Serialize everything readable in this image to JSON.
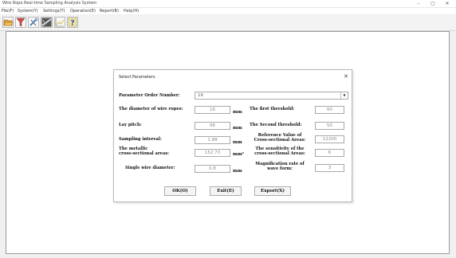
{
  "window": {
    "title": "Wire Rope Real-time Sampling Analysis System",
    "minimize": "–",
    "maximize": "▢",
    "close": "✕"
  },
  "menu": [
    "File(F)",
    "System(Y)",
    "Settings(T)",
    "Operation(E)",
    "Report(B)",
    "Help(H)"
  ],
  "toolbar": {
    "icons": [
      "folder-open-icon",
      "funnel-icon",
      "tools-icon",
      "rope-image-icon",
      "chart-icon",
      "help-icon"
    ]
  },
  "dialog": {
    "title": "Select Parameters",
    "close": "✕",
    "order": {
      "label": "Parameter Order Number:",
      "value": "16"
    },
    "left": [
      {
        "label": "The diameter of wire ropes:",
        "value": "16",
        "unit": "mm"
      },
      {
        "label": "Lay pitch:",
        "value": "96",
        "unit": "mm"
      },
      {
        "label": "Sampling interval:",
        "value": "1.88",
        "unit": "mm"
      },
      {
        "label": "The metallic\ncross-sectional areas:",
        "value": "152.73",
        "unit": "mm²"
      },
      {
        "label": "Single wire diameter:",
        "value": "0.8",
        "unit": "mm"
      }
    ],
    "right": [
      {
        "label": "The first threshold:",
        "value": "60"
      },
      {
        "label": "The Second threshold:",
        "value": "50"
      },
      {
        "label": "Reference Value of\nCross-sectional Areas:",
        "value": "12200"
      },
      {
        "label": "The sensitivity of the\ncross-sectional Areas:",
        "value": "6"
      },
      {
        "label": "Magnification rate of\nwave form:",
        "value": "3"
      }
    ],
    "buttons": {
      "ok": "OK(O)",
      "exit": "Exit(E)",
      "export": "Export(X)"
    }
  }
}
